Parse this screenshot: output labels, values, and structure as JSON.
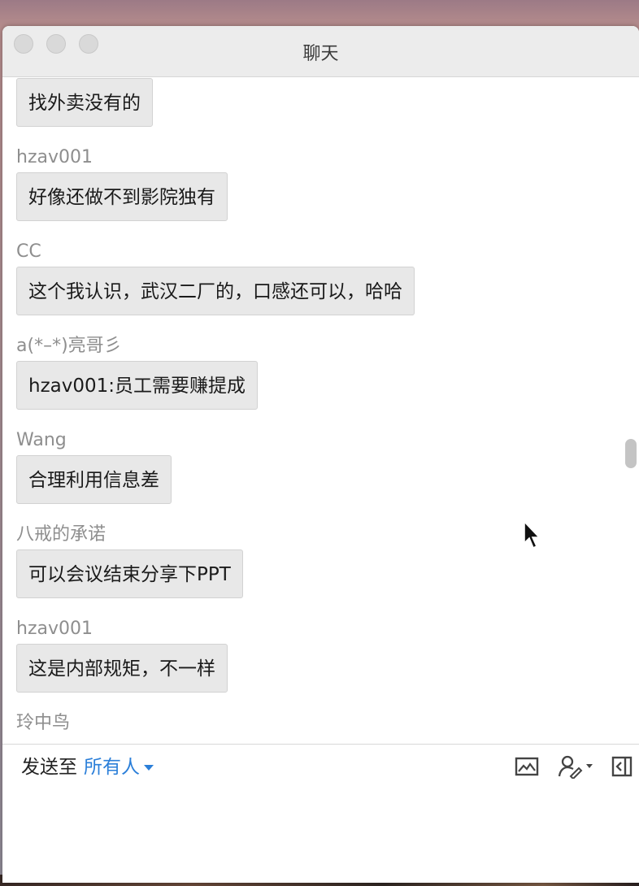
{
  "window": {
    "title": "聊天"
  },
  "messages": [
    {
      "sender": "",
      "text": "找外卖没有的"
    },
    {
      "sender": "hzav001",
      "text": "好像还做不到影院独有"
    },
    {
      "sender": "CC",
      "text": "这个我认识，武汉二厂的，口感还可以，哈哈"
    },
    {
      "sender": "a(*–*)亮哥彡",
      "text": "hzav001:员工需要赚提成"
    },
    {
      "sender": "Wang",
      "text": "合理利用信息差"
    },
    {
      "sender": "八戒的承诺",
      "text": "可以会议结束分享下PPT"
    },
    {
      "sender": "hzav001",
      "text": "这是内部规矩，不一样"
    },
    {
      "sender": "玲中鸟",
      "text": ""
    }
  ],
  "composer": {
    "send_to_label": "发送至",
    "recipient": "所有人",
    "tools": [
      "image-icon",
      "annotate-icon",
      "exit-panel-icon"
    ]
  },
  "colors": {
    "accent": "#2b7fd9",
    "bubble": "#e8e8e8",
    "sender": "#8e8e8e"
  }
}
